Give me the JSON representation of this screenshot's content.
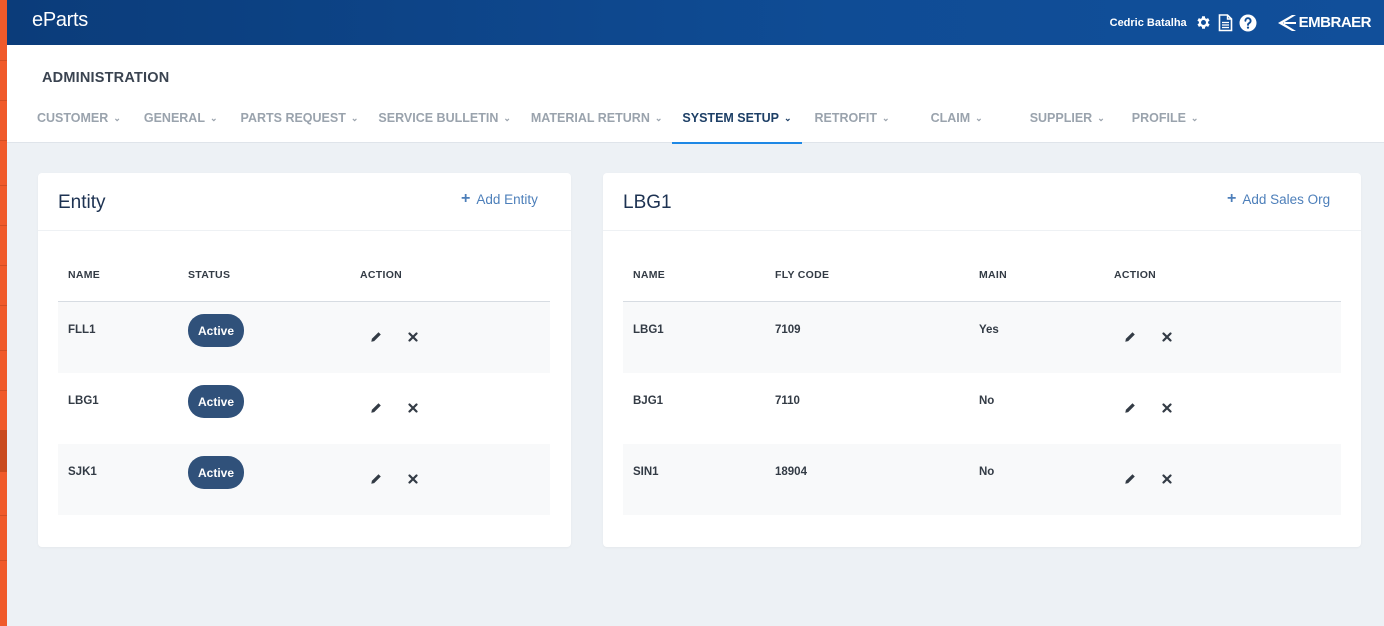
{
  "app": {
    "brand": "eParts",
    "user_name": "Cedric Batalha",
    "logo_text": "EMBRAER",
    "icons": [
      "gear-icon",
      "document-icon",
      "help-icon"
    ]
  },
  "page": {
    "title": "ADMINISTRATION"
  },
  "nav": {
    "tabs": [
      {
        "label": "CUSTOMER",
        "active": false
      },
      {
        "label": "GENERAL",
        "active": false
      },
      {
        "label": "PARTS REQUEST",
        "active": false
      },
      {
        "label": "SERVICE BULLETIN",
        "active": false
      },
      {
        "label": "MATERIAL RETURN",
        "active": false
      },
      {
        "label": "SYSTEM SETUP",
        "active": true
      },
      {
        "label": "RETROFIT",
        "active": false
      },
      {
        "label": "CLAIM",
        "active": false
      },
      {
        "label": "SUPPLIER",
        "active": false
      },
      {
        "label": "PROFILE",
        "active": false
      }
    ]
  },
  "entity_card": {
    "title": "Entity",
    "add_label": "Add Entity",
    "columns": [
      "NAME",
      "STATUS",
      "ACTION"
    ],
    "rows": [
      {
        "name": "FLL1",
        "status": "Active"
      },
      {
        "name": "LBG1",
        "status": "Active"
      },
      {
        "name": "SJK1",
        "status": "Active"
      }
    ]
  },
  "sales_org_card": {
    "title": "LBG1",
    "add_label": "Add Sales Org",
    "columns": [
      "NAME",
      "FLY CODE",
      "MAIN",
      "ACTION"
    ],
    "rows": [
      {
        "name": "LBG1",
        "fly_code": "7109",
        "main": "Yes"
      },
      {
        "name": "BJG1",
        "fly_code": "7110",
        "main": "No"
      },
      {
        "name": "SIN1",
        "fly_code": "18904",
        "main": "No"
      }
    ]
  },
  "colors": {
    "topbar": "#0f4c95",
    "accent": "#1e88e5",
    "badge": "#30517a",
    "edge_strip": "#f05a2a",
    "link": "#4d7fba"
  }
}
